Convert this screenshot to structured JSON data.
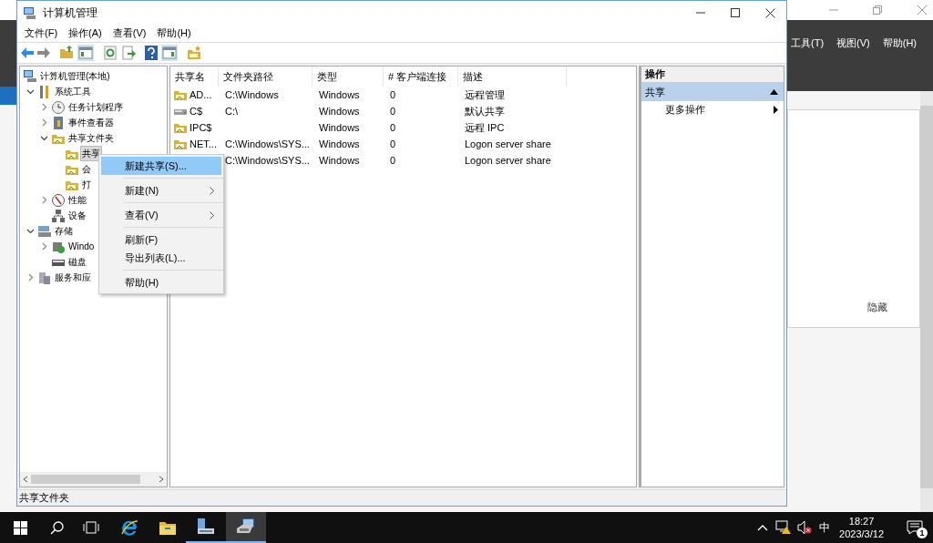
{
  "background_window": {
    "menu": [
      "工具(T)",
      "视图(V)",
      "帮助(H)"
    ],
    "hide_label": "隐藏"
  },
  "window": {
    "title": "计算机管理",
    "menu": [
      "文件(F)",
      "操作(A)",
      "查看(V)",
      "帮助(H)"
    ]
  },
  "tree": [
    {
      "label": "计算机管理(本地)",
      "kind": "root",
      "selected": false,
      "children": [
        {
          "label": "系统工具",
          "kind": "node",
          "expanded": true,
          "selected": false,
          "children": [
            {
              "label": "任务计划程序",
              "kind": "node",
              "expanded": false,
              "selected": false
            },
            {
              "label": "事件查看器",
              "kind": "node",
              "expanded": false,
              "selected": false
            },
            {
              "label": "共享文件夹",
              "kind": "node",
              "expanded": true,
              "selected": false,
              "children": [
                {
                  "label": "共享",
                  "kind": "leaf",
                  "selected": true
                },
                {
                  "label": "会",
                  "kind": "leaf",
                  "selected": false
                },
                {
                  "label": "打",
                  "kind": "leaf",
                  "selected": false
                }
              ]
            },
            {
              "label": "性能",
              "kind": "node",
              "expanded": false,
              "selected": false
            },
            {
              "label": "设备",
              "kind": "leaf",
              "selected": false
            }
          ]
        },
        {
          "label": "存储",
          "kind": "node",
          "expanded": true,
          "selected": false,
          "children": [
            {
              "label": "Windo",
              "kind": "node",
              "expanded": false,
              "selected": false
            },
            {
              "label": "磁盘",
              "kind": "leaf",
              "selected": false
            }
          ]
        },
        {
          "label": "服务和应",
          "kind": "node",
          "expanded": false,
          "selected": false
        }
      ]
    }
  ],
  "table": {
    "columns": [
      "共享名",
      "文件夹路径",
      "类型",
      "# 客户端连接",
      "描述"
    ],
    "rows": [
      {
        "kind": "share",
        "cells": [
          "AD...",
          "C:\\Windows",
          "Windows",
          "0",
          "远程管理"
        ]
      },
      {
        "kind": "drive",
        "cells": [
          "C$",
          "C:\\",
          "Windows",
          "0",
          "默认共享"
        ]
      },
      {
        "kind": "share",
        "cells": [
          "IPC$",
          "",
          "Windows",
          "0",
          "远程 IPC"
        ]
      },
      {
        "kind": "share",
        "cells": [
          "NET...",
          "C:\\Windows\\SYS...",
          "Windows",
          "0",
          "Logon server share"
        ]
      },
      {
        "cells": [
          "",
          "C:\\Windows\\SYS...",
          "Windows",
          "0",
          "Logon server share"
        ]
      }
    ]
  },
  "actions": {
    "header": "操作",
    "section": "共享",
    "items": [
      "更多操作"
    ]
  },
  "context_menu": [
    {
      "kind": "item",
      "label": "新建共享(S)...",
      "selected": true
    },
    {
      "kind": "separator"
    },
    {
      "kind": "submenu",
      "label": "新建(N)",
      "selected": false
    },
    {
      "kind": "separator"
    },
    {
      "kind": "submenu",
      "label": "查看(V)",
      "selected": false
    },
    {
      "kind": "separator"
    },
    {
      "kind": "item",
      "label": "刷新(F)",
      "selected": false
    },
    {
      "kind": "item",
      "label": "导出列表(L)...",
      "selected": false
    },
    {
      "kind": "separator"
    },
    {
      "kind": "item",
      "label": "帮助(H)",
      "selected": false
    }
  ],
  "status_bar": "共享文件夹",
  "taskbar": {
    "input_method": "中",
    "time": "18:27",
    "date": "2023/3/12",
    "notification_count": "1"
  }
}
